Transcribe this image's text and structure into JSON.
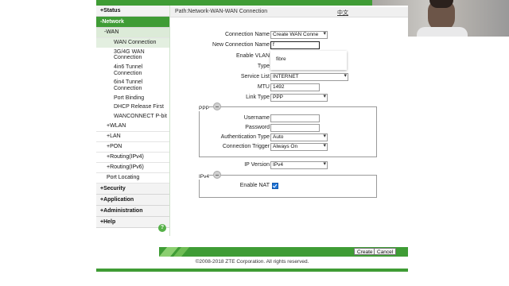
{
  "sidebar": {
    "status": "+Status",
    "network": "-Network",
    "wan": "-WAN",
    "wan_items": [
      "WAN Connection",
      "3G/4G WAN Connection",
      "4in6 Tunnel Connection",
      "6in4 Tunnel Connection",
      "Port Binding",
      "DHCP Release First",
      "WANCONNECT P-bit"
    ],
    "wlan": "+WLAN",
    "lan": "+LAN",
    "pon": "+PON",
    "routing_ipv4": "+Routing(IPv4)",
    "routing_ipv6": "+Routing(IPv6)",
    "port_locating": "Port Locating",
    "security": "+Security",
    "application": "+Application",
    "administration": "+Administration",
    "help": "+Help",
    "help_icon": "?"
  },
  "header": {
    "path": "Path:Network-WAN-WAN Connection",
    "lang": "中文"
  },
  "form": {
    "connection_name_label": "Connection Name",
    "connection_name_value": "Create WAN Conne",
    "new_connection_name_label": "New Connection Name",
    "new_connection_name_value": "f",
    "enable_vlan_label": "Enable VLAN",
    "type_label": "Type",
    "service_list_label": "Service List",
    "service_list_value": "INTERNET",
    "mtu_label": "MTU",
    "mtu_value": "1492",
    "link_type_label": "Link Type",
    "link_type_value": "PPP",
    "autocomplete_option": "fibre",
    "ppp": {
      "title": "PPP",
      "username_label": "Username",
      "password_label": "Password",
      "auth_type_label": "Authentication Type",
      "auth_type_value": "Auto",
      "trigger_label": "Connection Trigger",
      "trigger_value": "Always On"
    },
    "ip_version_label": "IP Version",
    "ip_version_value": "IPv4",
    "ipv4": {
      "title": "IPv4",
      "enable_nat_label": "Enable NAT",
      "enable_nat_checked": true
    }
  },
  "buttons": {
    "create": "Create",
    "cancel": "Cancel"
  },
  "footer": {
    "copyright": "©2008-2018 ZTE Corporation. All rights reserved."
  },
  "colors": {
    "brand_green": "#3f9c35",
    "checkbox_blue": "#1d73d8"
  }
}
